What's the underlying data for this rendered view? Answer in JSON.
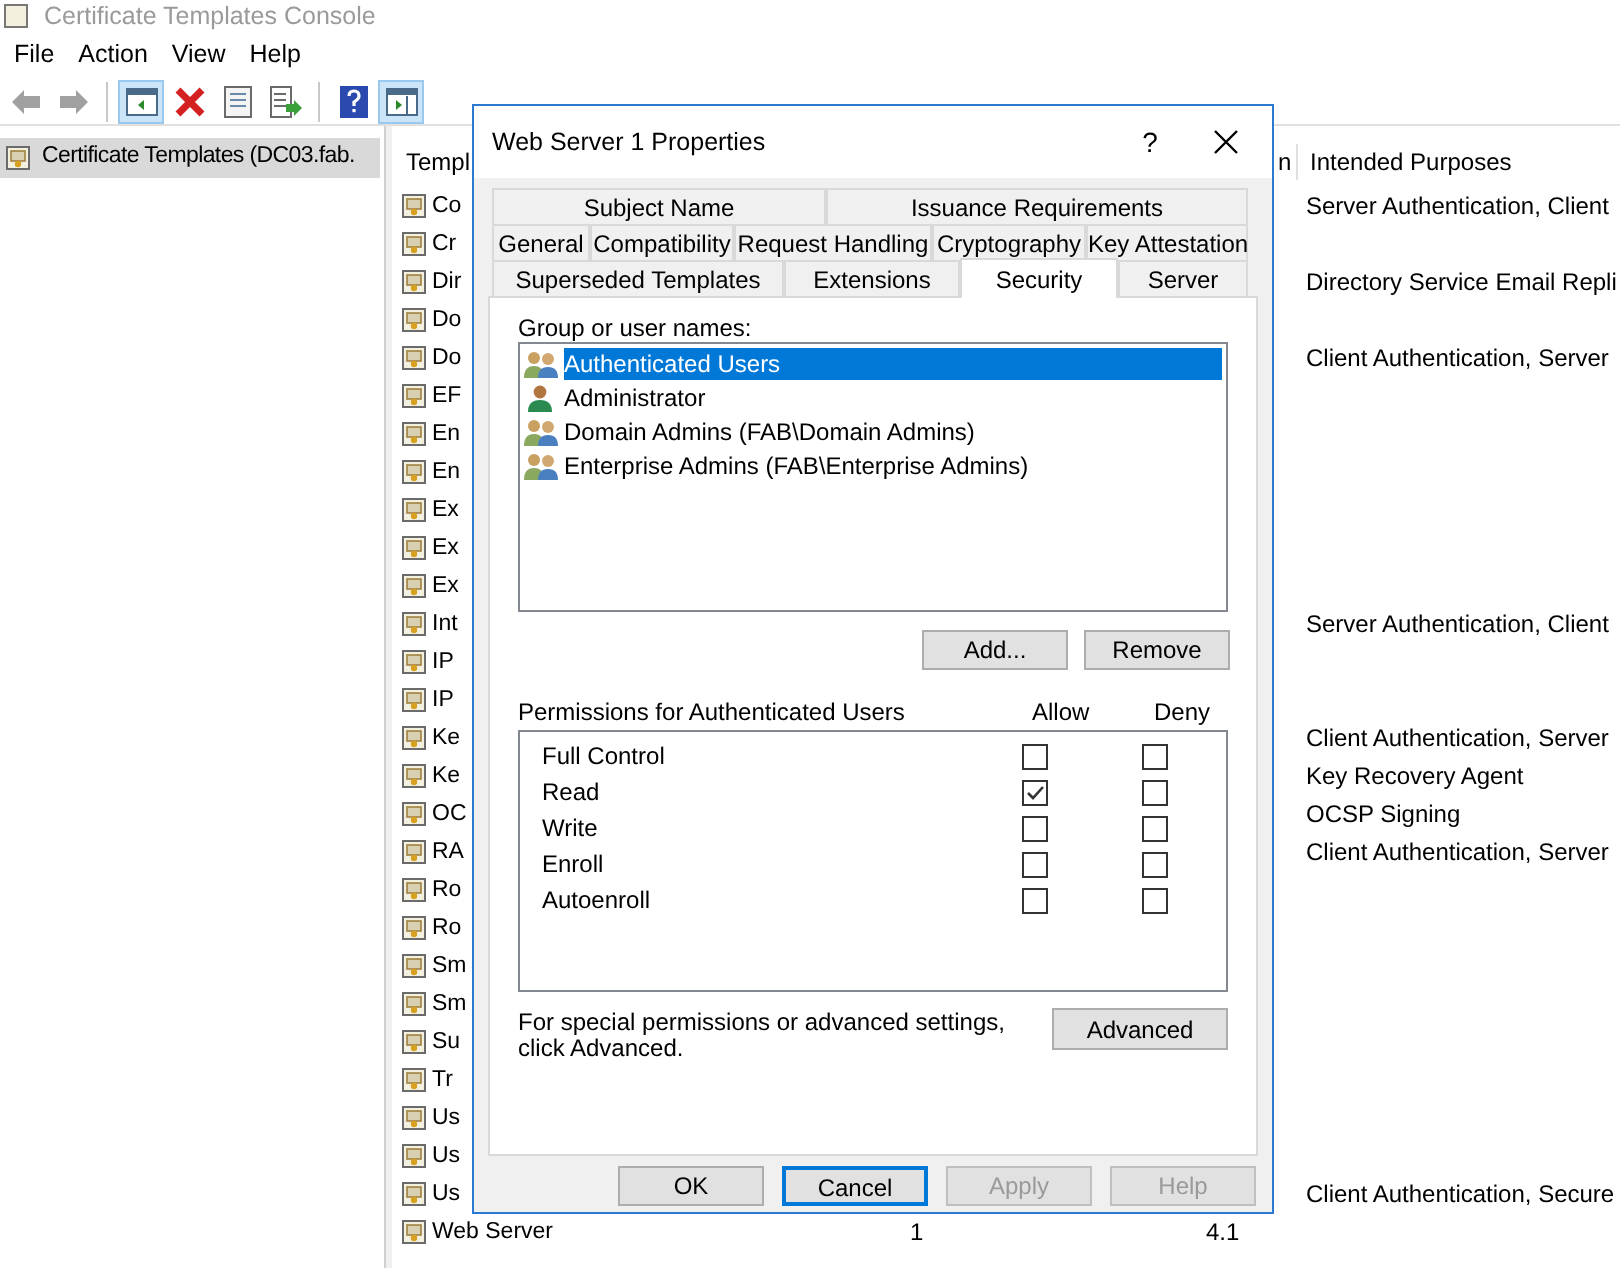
{
  "window": {
    "title": "Certificate Templates Console"
  },
  "menu": [
    "File",
    "Action",
    "View",
    "Help"
  ],
  "toolbar": [
    {
      "kind": "back",
      "pressed": false
    },
    {
      "kind": "forward",
      "pressed": false
    },
    {
      "kind": "separator"
    },
    {
      "kind": "tree",
      "pressed": true
    },
    {
      "kind": "delete",
      "pressed": false
    },
    {
      "kind": "properties",
      "pressed": false
    },
    {
      "kind": "export",
      "pressed": false
    },
    {
      "kind": "separator"
    },
    {
      "kind": "help",
      "pressed": false
    },
    {
      "kind": "pane",
      "pressed": true
    }
  ],
  "tree": {
    "items": [
      {
        "label": "Certificate Templates (DC03.fab.",
        "selected": true
      }
    ]
  },
  "table": {
    "columns": [
      "Templ",
      "n",
      "Intended Purposes"
    ],
    "rows": [
      {
        "name": "Co",
        "purposes": "Server Authentication, Client"
      },
      {
        "name": "Cr"
      },
      {
        "name": "Dir",
        "purposes": "Directory Service Email Repli"
      },
      {
        "name": "Do"
      },
      {
        "name": "Do",
        "purposes": "Client Authentication, Server"
      },
      {
        "name": "EF"
      },
      {
        "name": "En"
      },
      {
        "name": "En"
      },
      {
        "name": "Ex"
      },
      {
        "name": "Ex"
      },
      {
        "name": "Ex"
      },
      {
        "name": "Int",
        "purposes": "Server Authentication, Client"
      },
      {
        "name": "IP"
      },
      {
        "name": "IP"
      },
      {
        "name": "Ke",
        "purposes": "Client Authentication, Server"
      },
      {
        "name": "Ke",
        "purposes": "Key Recovery Agent"
      },
      {
        "name": "OC",
        "purposes": "OCSP Signing"
      },
      {
        "name": "RA",
        "purposes": "Client Authentication, Server"
      },
      {
        "name": "Ro"
      },
      {
        "name": "Ro"
      },
      {
        "name": "Sm"
      },
      {
        "name": "Sm"
      },
      {
        "name": "Su"
      },
      {
        "name": "Tr"
      },
      {
        "name": "Us"
      },
      {
        "name": "Us"
      },
      {
        "name": "Us",
        "purposes": "Client Authentication, Secure"
      },
      {
        "name": "Web Server",
        "schema": "1",
        "version": "4.1"
      }
    ]
  },
  "dialog": {
    "title": "Web Server 1 Properties",
    "help": "?",
    "tab_rows": [
      [
        {
          "label": "Subject Name",
          "selected": false
        },
        {
          "label": "Issuance Requirements",
          "selected": false
        }
      ],
      [
        {
          "label": "General",
          "selected": false
        },
        {
          "label": "Compatibility",
          "selected": false
        },
        {
          "label": "Request Handling",
          "selected": false
        },
        {
          "label": "Cryptography",
          "selected": false
        },
        {
          "label": "Key Attestation",
          "selected": false
        }
      ],
      [
        {
          "label": "Superseded Templates",
          "selected": false
        },
        {
          "label": "Extensions",
          "selected": false
        },
        {
          "label": "Security",
          "selected": true
        },
        {
          "label": "Server",
          "selected": false
        }
      ]
    ],
    "group_label": "Group or user names:",
    "users": [
      {
        "name": "Authenticated Users",
        "kind": "group",
        "selected": true
      },
      {
        "name": "Administrator",
        "kind": "user",
        "selected": false
      },
      {
        "name": "Domain Admins (FAB\\Domain Admins)",
        "kind": "group",
        "selected": false
      },
      {
        "name": "Enterprise Admins (FAB\\Enterprise Admins)",
        "kind": "group",
        "selected": false
      }
    ],
    "user_buttons": [
      "Add...",
      "Remove"
    ],
    "permissions_label": "Permissions for Authenticated Users",
    "allow_label": "Allow",
    "deny_label": "Deny",
    "permissions": [
      {
        "name": "Full Control",
        "allow": false,
        "deny": false
      },
      {
        "name": "Read",
        "allow": true,
        "deny": false
      },
      {
        "name": "Write",
        "allow": false,
        "deny": false
      },
      {
        "name": "Enroll",
        "allow": false,
        "deny": false
      },
      {
        "name": "Autoenroll",
        "allow": false,
        "deny": false
      }
    ],
    "advanced_text": "For special permissions or advanced settings, click Advanced.",
    "advanced_button": "Advanced",
    "buttons": [
      {
        "label": "OK",
        "disabled": false,
        "focused": false
      },
      {
        "label": "Cancel",
        "disabled": false,
        "focused": true
      },
      {
        "label": "Apply",
        "disabled": true,
        "focused": false
      },
      {
        "label": "Help",
        "disabled": true,
        "focused": false
      }
    ]
  }
}
